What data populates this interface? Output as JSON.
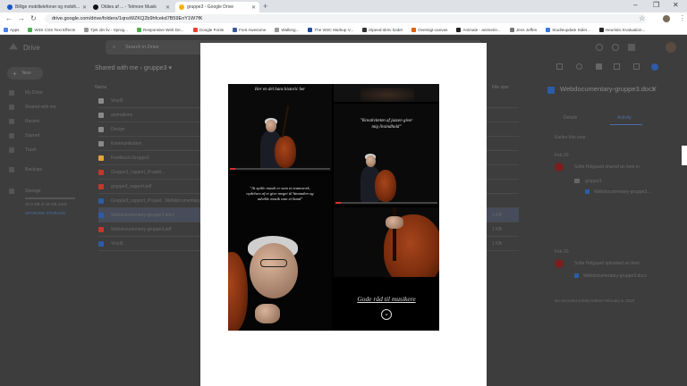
{
  "browser": {
    "tabs": [
      {
        "title": "Billige mobiltelefoner og mobilt...",
        "favicon_color": "#1a56c9"
      },
      {
        "title": "Oldies af ... - Telmore Musik",
        "favicon_color": "#111111"
      },
      {
        "title": "gruppe3 - Google Drive",
        "favicon_color": "#f4b400"
      }
    ],
    "url": "drive.google.com/drive/folders/1qnsWZKQ2b9hfcekd7B59EnY1W7fK",
    "bookmarks": [
      {
        "label": "Apps",
        "color": "#4285f4"
      },
      {
        "label": "W3S CSS Text Effects",
        "color": "#4caf50"
      },
      {
        "label": "Tjek din liv - Sprog...",
        "color": "#999999"
      },
      {
        "label": "Responsive Web De...",
        "color": "#4caf50"
      },
      {
        "label": "Google Fonts",
        "color": "#ea4335"
      },
      {
        "label": "Font Awesome",
        "color": "#3b5998"
      },
      {
        "label": "Walking...",
        "color": "#999999"
      },
      {
        "label": "The W3C Markup V...",
        "color": "#1e4e9c"
      },
      {
        "label": "iSpeed-skriv koder",
        "color": "#333333"
      },
      {
        "label": "Oversigt-canvas",
        "color": "#e66000"
      },
      {
        "label": "Animate - animerin...",
        "color": "#222222"
      },
      {
        "label": "Jens Jeffen",
        "color": "#777777"
      },
      {
        "label": "Studieupdate Sider...",
        "color": "#3c78d8"
      },
      {
        "label": "Heuristic Evaluation...",
        "color": "#222222"
      }
    ]
  },
  "drive": {
    "logo": "Drive",
    "search_placeholder": "Search in Drive",
    "new_label": "New",
    "sidebar": [
      "My Drive",
      "Shared with me",
      "Recent",
      "Starred",
      "Trash",
      "Backups",
      "Storage"
    ],
    "storage_text": "10.9 GB of 15 GB used",
    "upgrade_label": "UPGRADE STORAGE",
    "breadcrumb": [
      "Shared with me",
      "gruppe3"
    ],
    "column_name": "Name",
    "column_size": "File size",
    "files": [
      {
        "name": "Vinyl9",
        "color": "#8a8a8a",
        "size": ""
      },
      {
        "name": "animations",
        "color": "#8a8a8a",
        "size": ""
      },
      {
        "name": "Design",
        "color": "#8a8a8a",
        "size": ""
      },
      {
        "name": "Kommunikation",
        "color": "#8a8a8a",
        "size": ""
      },
      {
        "name": "Feedback.Gruppe3",
        "color": "#e6a23c",
        "size": ""
      },
      {
        "name": "Gruppe3_rapport_Projekt...",
        "color": "#c0392b",
        "size": ""
      },
      {
        "name": "gruppe3_rapport.pdf",
        "color": "#c0392b",
        "size": ""
      },
      {
        "name": "Gruppe3_rapport_Projekt...Webdocumentary",
        "color": "#2c5ba8",
        "size": ""
      },
      {
        "name": "Webdocumentary-gruppe3.docx",
        "color": "#2c5ba8",
        "size": "1 KB"
      },
      {
        "name": "Webdocumentary-gruppe3.pdf",
        "color": "#c0392b",
        "size": "1 KB"
      },
      {
        "name": "Vinyl9",
        "color": "#2c5ba8",
        "size": "1 KB"
      }
    ],
    "details": {
      "title": "Webdocumentary-gruppe3.docx",
      "tab_details": "Details",
      "tab_activity": "Activity",
      "section": "Earlier this year",
      "entry1_date": "Feb 20",
      "entry1_text": "Sofie Holgaard shared an item in",
      "entry1_folder": "gruppe3",
      "entry1_file": "Webdocumentary-gruppe3...",
      "entry2_date": "Feb 20",
      "entry2_text": "Sofie Holgaard uploaded an item",
      "entry2_file": "Webdocumentary-gruppe3.docx",
      "footer": "No recorded activity before February 5, 2019"
    }
  },
  "document": {
    "panel1_quote": "Her en del hans historic her",
    "panel2_quote": "\"Kreativiteten af jazzen giver mig livsindhold\"",
    "panel3_quote": "\"At spille musik er som et teamwork, nydelsen af et give meget til hinanden og udvikle musik som et band\"",
    "cta": "Gode råd til musikere",
    "cta_icon": "chevron-down-circle",
    "video_progress_1": 0.05,
    "video_progress_2": 0.05
  }
}
